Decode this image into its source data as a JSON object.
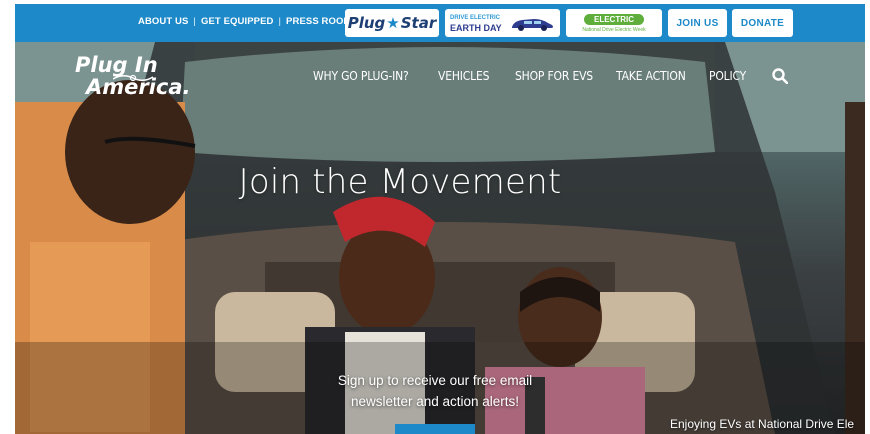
{
  "topbar": {
    "links": [
      "ABOUT US",
      "GET EQUIPPED",
      "PRESS ROOM"
    ],
    "badges": {
      "plugstar": {
        "left": "Plug",
        "right": "Star"
      },
      "earthday": {
        "top": "DRIVE ELECTRIC",
        "bottom": "EARTH DAY"
      },
      "electric": {
        "top": "ELECTRIC",
        "bottom": "National Drive Electric Week"
      }
    },
    "join_label": "JOIN US",
    "donate_label": "DONATE"
  },
  "logo": {
    "line1": "Plug In",
    "line2": "America."
  },
  "nav": {
    "items": [
      "WHY GO PLUG-IN?",
      "VEHICLES",
      "SHOP FOR EVS",
      "TAKE ACTION",
      "POLICY"
    ]
  },
  "hero": {
    "headline": "Join the Movement",
    "signup_line1": "Sign up to receive our free email",
    "signup_line2": "newsletter and action alerts!",
    "caption": "Enjoying EVs at National Drive Ele"
  },
  "colors": {
    "brand_blue": "#1d89c8",
    "navy": "#1d3f73",
    "green": "#5fae3c"
  }
}
